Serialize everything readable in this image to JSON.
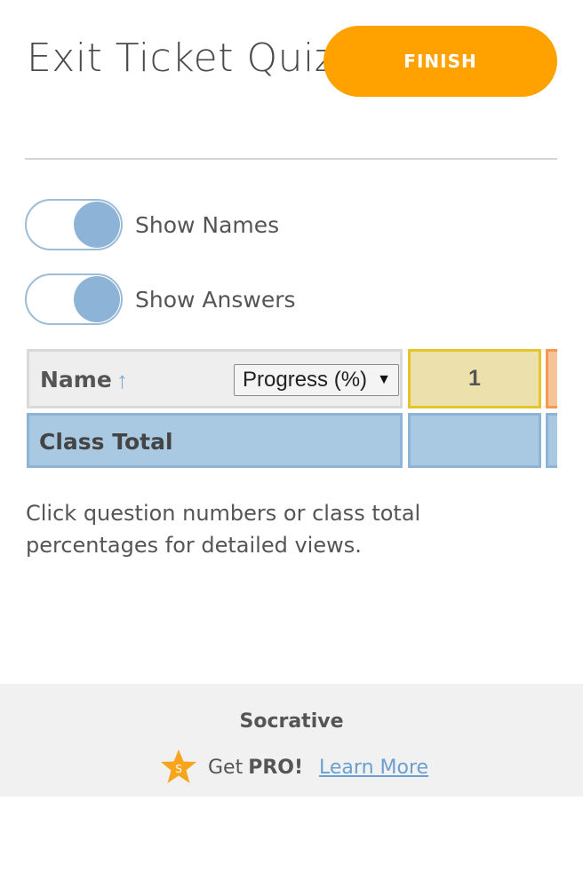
{
  "header": {
    "title": "Exit Ticket Quiz",
    "finish_label": "FINISH"
  },
  "toggles": [
    {
      "label": "Show Names",
      "on": true
    },
    {
      "label": "Show Answers",
      "on": true
    }
  ],
  "table": {
    "name_header": "Name",
    "sort_icon": "arrow-up-icon",
    "sort_glyph": "↑",
    "progress_select": {
      "selected": "Progress (%)",
      "caret": "▼"
    },
    "question_headers": [
      "1"
    ],
    "class_total_label": "Class Total"
  },
  "hint": "Click question numbers or class total percentages for detailed views.",
  "footer": {
    "brand": "Socrative",
    "star_letter": "S",
    "get_text": "Get",
    "pro_text": "PRO!",
    "learn_more": "Learn More"
  },
  "colors": {
    "accent_orange": "#ffa200",
    "toggle_blue": "#8db4d7",
    "question_yellow": "#ece0ac",
    "class_total_blue": "#a9c8e1",
    "link_blue": "#6a9fcf"
  }
}
